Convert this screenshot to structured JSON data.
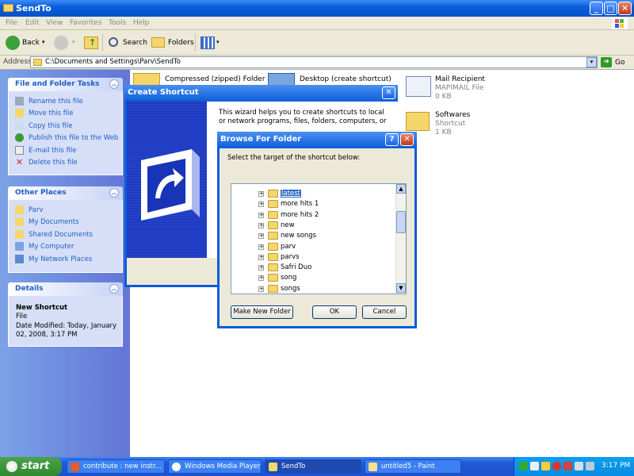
{
  "window": {
    "title": "SendTo"
  },
  "menu": [
    "File",
    "Edit",
    "View",
    "Favorites",
    "Tools",
    "Help"
  ],
  "toolbar": {
    "back": "Back",
    "search": "Search",
    "folders": "Folders"
  },
  "address": {
    "label": "Address",
    "path": "C:\\Documents and Settings\\Parv\\SendTo",
    "go": "Go"
  },
  "tasks": {
    "title": "File and Folder Tasks",
    "items": [
      "Rename this file",
      "Move this file",
      "Copy this file",
      "Publish this file to the Web",
      "E-mail this file",
      "Delete this file"
    ]
  },
  "places": {
    "title": "Other Places",
    "items": [
      "Parv",
      "My Documents",
      "Shared Documents",
      "My Computer",
      "My Network Places"
    ]
  },
  "details": {
    "title": "Details",
    "name": "New Shortcut",
    "type": "File",
    "modified": "Date Modified: Today, January 02, 2008, 3:17 PM"
  },
  "files": [
    {
      "name": "Compressed (zipped) Folder"
    },
    {
      "name": "Desktop (create shortcut)"
    },
    {
      "name": "Mail Recipient",
      "type": "MAPIMAIL File",
      "size": "0 KB"
    },
    {
      "name": "Softwares",
      "type": "Shortcut",
      "size": "1 KB"
    }
  ],
  "wizard": {
    "title": "Create Shortcut",
    "text": "This wizard helps you to create shortcuts to local or network programs, files, folders, computers, or Internet addresses."
  },
  "browse": {
    "title": "Browse For Folder",
    "prompt": "Select the target of the shortcut below:",
    "folders": [
      "latest",
      "more hits 1",
      "more hits 2",
      "new",
      "new songs",
      "parv",
      "parvs",
      "Safri Duo",
      "song",
      "songs"
    ],
    "selected": "latest",
    "make_new": "Make New Folder",
    "ok": "OK",
    "cancel": "Cancel"
  },
  "taskbar": {
    "start": "start",
    "items": [
      "contribute : new instr...",
      "Windows Media Player",
      "SendTo",
      "untitled5 - Paint"
    ],
    "active": "SendTo",
    "clock": "3:17 PM"
  }
}
